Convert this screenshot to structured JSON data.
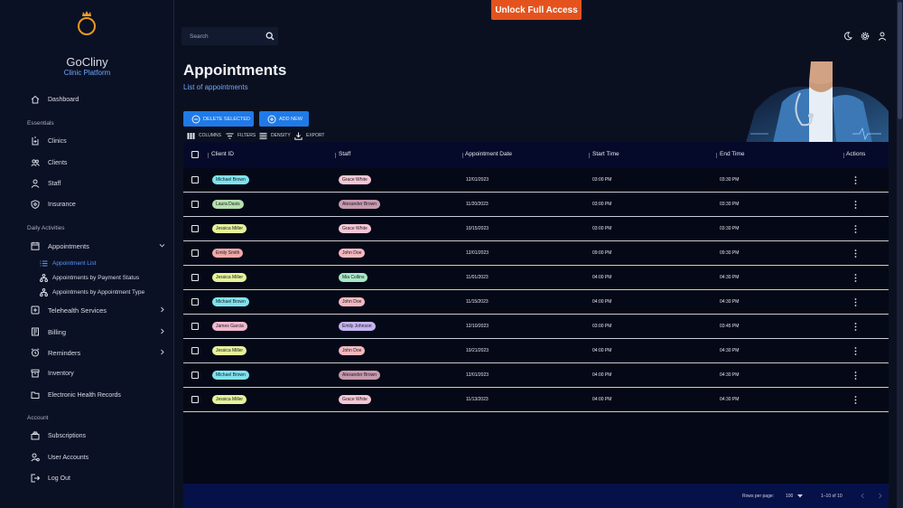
{
  "brand": {
    "name": "GoCliny",
    "subtitle": "Clinic Platform"
  },
  "topbar": {
    "unlock_label": "Unlock Full Access",
    "search_placeholder": "Search"
  },
  "sidebar": {
    "dashboard": "Dashboard",
    "sections": {
      "essentials": "Essentials",
      "daily": "Daily Activities",
      "account": "Account"
    },
    "essentials": [
      "Clinics",
      "Clients",
      "Staff",
      "Insurance"
    ],
    "appointments": "Appointments",
    "appointment_sub": [
      "Appointment List",
      "Appointments by Payment Status",
      "Appointments by Appointment Type"
    ],
    "daily": [
      "Telehealth Services",
      "Billing",
      "Reminders",
      "Inventory",
      "Electronic Health Records"
    ],
    "account": [
      "Subscriptions",
      "User Accounts",
      "Log Out"
    ]
  },
  "header": {
    "title": "Appointments",
    "subtitle": "List of appointments"
  },
  "actions": {
    "delete_selected": "DELETE SELECTED",
    "add_new": "ADD NEW"
  },
  "toolbar": {
    "columns": "COLUMNS",
    "filters": "FILTERS",
    "density": "DENSITY",
    "export": "EXPORT"
  },
  "table": {
    "columns": [
      "Client ID",
      "Staff",
      "Appointment Date",
      "Start Time",
      "End Time",
      "Actions"
    ],
    "rows": [
      {
        "client": "Michael Brown",
        "client_color": "#7ee3ef",
        "staff": "Grace White",
        "staff_color": "#f6c7d6",
        "date": "12/01/2023",
        "start": "03:00 PM",
        "end": "03:30 PM"
      },
      {
        "client": "Laura Davis",
        "client_color": "#b6e0b0",
        "staff": "Alexander Brown",
        "staff_color": "#c89ab0",
        "date": "11/20/2023",
        "start": "03:00 PM",
        "end": "03:30 PM"
      },
      {
        "client": "Jessica Miller",
        "client_color": "#e6f39b",
        "staff": "Grace White",
        "staff_color": "#f6c7d6",
        "date": "10/15/2023",
        "start": "03:00 PM",
        "end": "03:30 PM"
      },
      {
        "client": "Emily Smith",
        "client_color": "#f0a8a8",
        "staff": "John Doe",
        "staff_color": "#f3b8c0",
        "date": "12/01/2023",
        "start": "09:00 PM",
        "end": "09:30 PM"
      },
      {
        "client": "Jessica Miller",
        "client_color": "#e6f39b",
        "staff": "Mia Collins",
        "staff_color": "#a8e8c8",
        "date": "11/01/2023",
        "start": "04:00 PM",
        "end": "04:30 PM"
      },
      {
        "client": "Michael Brown",
        "client_color": "#7ee3ef",
        "staff": "John Doe",
        "staff_color": "#f3b8c0",
        "date": "11/15/2023",
        "start": "04:00 PM",
        "end": "04:30 PM"
      },
      {
        "client": "James Garcia",
        "client_color": "#f2b8d0",
        "staff": "Emily Johnson",
        "staff_color": "#c4b4f0",
        "date": "12/10/2023",
        "start": "03:00 PM",
        "end": "03:45 PM"
      },
      {
        "client": "Jessica Miller",
        "client_color": "#e6f39b",
        "staff": "John Doe",
        "staff_color": "#f3b8c0",
        "date": "10/21/2023",
        "start": "04:00 PM",
        "end": "04:30 PM"
      },
      {
        "client": "Michael Brown",
        "client_color": "#7ee3ef",
        "staff": "Alexander Brown",
        "staff_color": "#c89ab0",
        "date": "12/01/2023",
        "start": "04:00 PM",
        "end": "04:30 PM"
      },
      {
        "client": "Jessica Miller",
        "client_color": "#e6f39b",
        "staff": "Grace White",
        "staff_color": "#f6c7d6",
        "date": "11/13/2023",
        "start": "04:00 PM",
        "end": "04:30 PM"
      }
    ]
  },
  "pagination": {
    "rows_per_page_label": "Rows per page:",
    "rows_per_page": "100",
    "range": "1–10 of 10"
  },
  "colors": {
    "accent": "#1f7ae8",
    "unlock": "#e4531d",
    "link": "#6ea8ff"
  }
}
